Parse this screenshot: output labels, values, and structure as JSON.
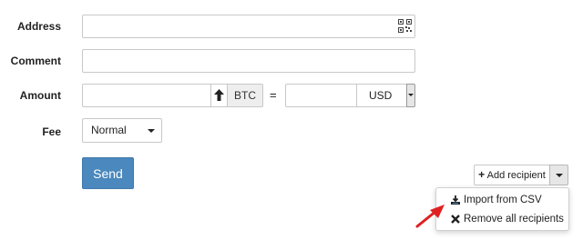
{
  "form": {
    "address_label": "Address",
    "comment_label": "Comment",
    "amount_label": "Amount",
    "fee_label": "Fee",
    "address_value": "",
    "comment_value": "",
    "amount_crypto_value": "",
    "amount_fiat_value": "",
    "crypto_unit": "BTC",
    "equals": "=",
    "fiat_currency": "USD",
    "fee_value": "Normal"
  },
  "actions": {
    "send_label": "Send",
    "add_recipient_label": "Add recipient",
    "menu": [
      {
        "label": "Import from CSV",
        "icon": "import-icon"
      },
      {
        "label": "Remove all recipients",
        "icon": "remove-icon"
      }
    ]
  },
  "colors": {
    "send_button": "#4a88bd",
    "annotation_arrow": "#e02020"
  }
}
